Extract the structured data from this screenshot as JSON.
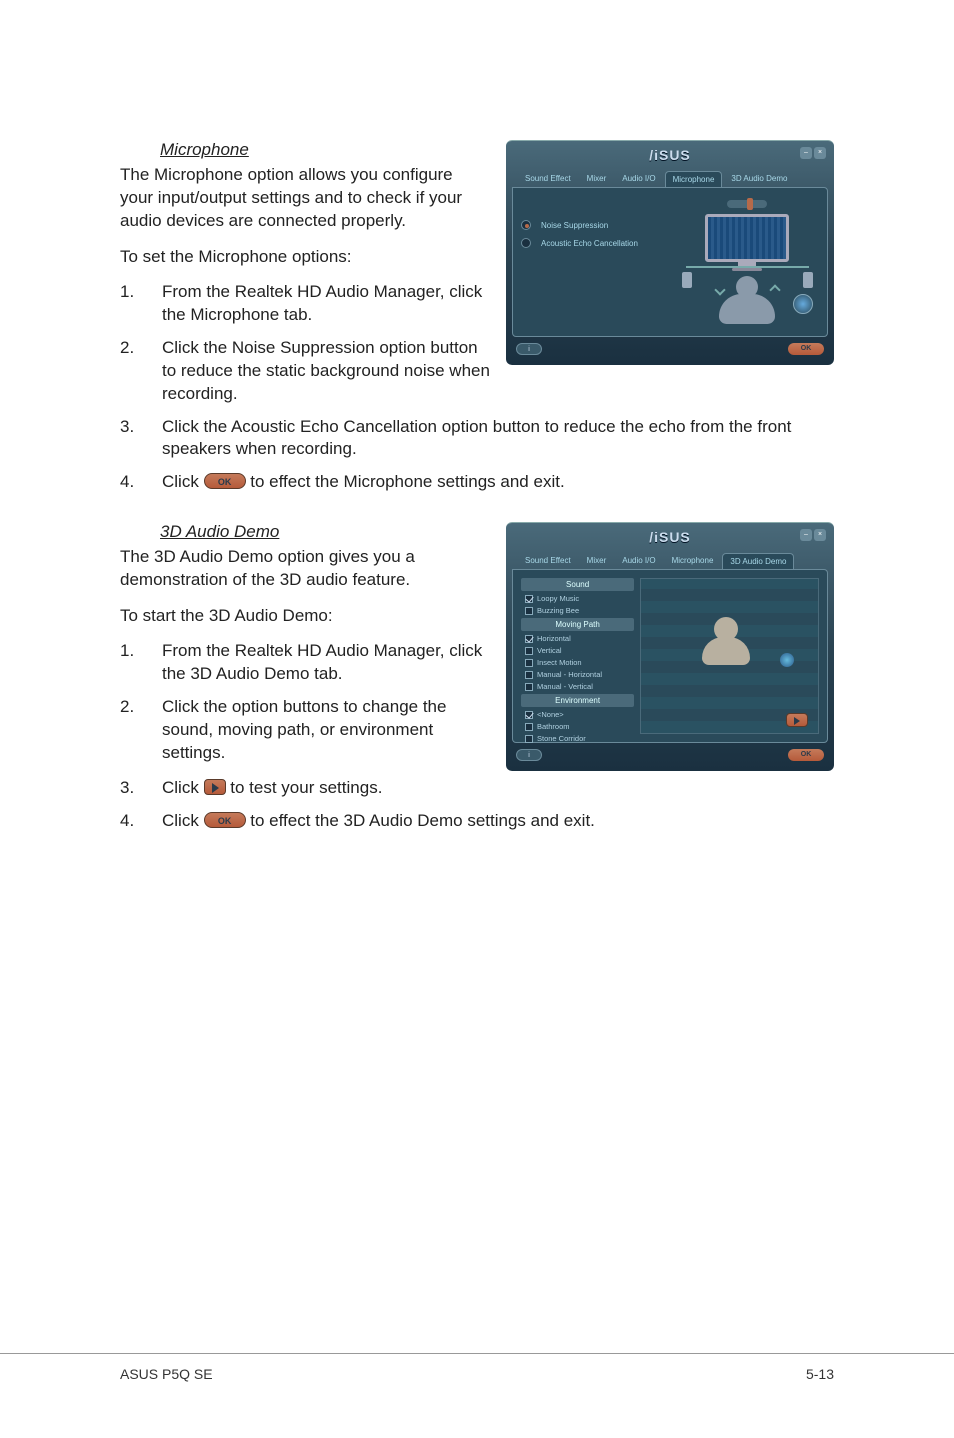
{
  "sections": {
    "mic": {
      "heading": "Microphone",
      "intro": "The Microphone option allows you configure your input/output settings and to check if your audio devices are connected properly.",
      "lead": "To set the Microphone options:",
      "steps": [
        "From the Realtek HD Audio Manager, click the Microphone tab.",
        "Click the Noise Suppression option button to reduce the static background noise when recording.",
        "Click the Acoustic Echo Cancellation option button to reduce the echo from the front speakers when recording.",
        [
          "Click ",
          "OK",
          " to effect the Microphone settings and exit."
        ]
      ]
    },
    "demo": {
      "heading": "3D Audio Demo",
      "intro": "The 3D Audio Demo option gives you a demonstration of the 3D audio feature.",
      "lead": "To start the 3D Audio Demo:",
      "steps": [
        "From the Realtek HD Audio Manager, click the 3D Audio Demo tab.",
        "Click the option buttons to change the sound, moving path, or environment settings.",
        [
          "Click ",
          "PLAY",
          " to test your settings."
        ],
        [
          "Click ",
          "OK",
          " to effect the 3D Audio Demo settings and exit."
        ]
      ]
    }
  },
  "panel": {
    "logo": "/iSUS",
    "tabs": [
      "Sound Effect",
      "Mixer",
      "Audio I/O",
      "Microphone",
      "3D Audio Demo"
    ],
    "mic_active_tab": "Microphone",
    "demo_active_tab": "3D Audio Demo",
    "mic_options": [
      "Noise Suppression",
      "Acoustic Echo Cancellation"
    ],
    "demo_groups": {
      "sound": {
        "title": "Sound",
        "items": [
          "Loopy Music",
          "Buzzing Bee"
        ],
        "selected": 0
      },
      "path": {
        "title": "Moving Path",
        "items": [
          "Horizontal",
          "Vertical",
          "Insect Motion",
          "Manual - Horizontal",
          "Manual - Vertical"
        ],
        "selected": 0
      },
      "env": {
        "title": "Environment",
        "items": [
          "<None>",
          "Bathroom",
          "Stone Corridor"
        ],
        "selected": 0
      }
    },
    "info_btn": "i",
    "ok_btn": "OK",
    "minimize": "–",
    "close": "×"
  },
  "footer": {
    "left": "ASUS P5Q SE",
    "right": "5-13"
  },
  "ok_label": "OK"
}
